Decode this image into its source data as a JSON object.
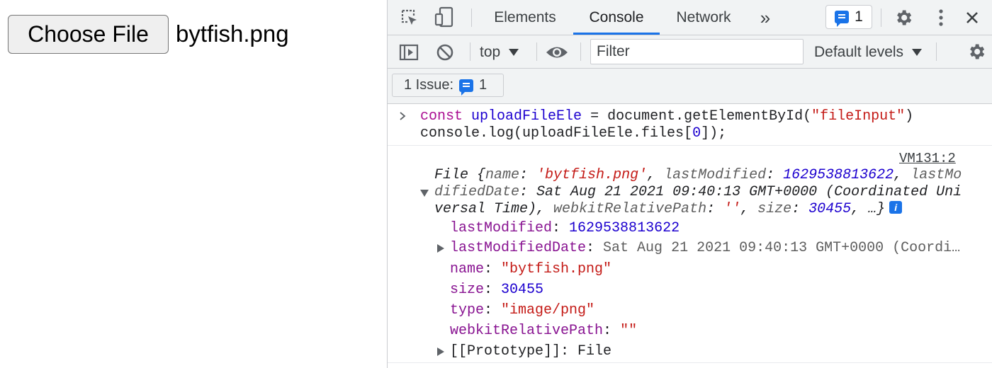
{
  "page": {
    "file_button_label": "Choose File",
    "file_name": "bytfish.png"
  },
  "devtools": {
    "tabs": [
      "Elements",
      "Console",
      "Network"
    ],
    "active_tab": "Console",
    "more_tabs_glyph": "»",
    "message_badge_count": "1",
    "context": "top",
    "filter_placeholder": "Filter",
    "levels_label": "Default levels",
    "issues_label": "1 Issue:",
    "issues_count": "1",
    "accent_color": "#1a73e8",
    "icons": [
      "inspect-element-icon",
      "device-toggle-icon",
      "settings-gear-icon",
      "kebab-menu-icon",
      "close-icon",
      "sidebar-toggle-icon",
      "clear-console-icon",
      "eye-icon",
      "chat-bubble-icon"
    ]
  },
  "console": {
    "input_line1": {
      "kw": "const",
      "var": "uploadFileEle",
      "eq": " = document.getElementById(",
      "str": "\"fileInput\"",
      "close": ")"
    },
    "input_line2": {
      "pre": "console.log(uploadFileEle.files[",
      "idx": "0",
      "post": "]);"
    },
    "source_link": "VM131:2",
    "summary": {
      "l1a": "File {",
      "l1k1": "name",
      "l1c": ": ",
      "l1s": "'bytfish.png'",
      "l1d": ", ",
      "l1k2": "lastModified",
      "l1e": ": ",
      "l1n": "1629538813622",
      "l1f": ", ",
      "l1k3": "lastMo",
      "l2k": "difiedDate",
      "l2v": ": Sat Aug 21 2021 09:40:13 GMT+0000 (Coordinated Uni",
      "l3a": "versal Time), ",
      "l3k1": "webkitRelativePath",
      "l3b": ": ",
      "l3s": "''",
      "l3c": ", ",
      "l3k2": "size",
      "l3d": ": ",
      "l3n": "30455",
      "l3e": ", …}",
      "info_glyph": "i"
    },
    "properties": {
      "lastModified_key": "lastModified",
      "lastModified_val": "1629538813622",
      "lastModifiedDate_key": "lastModifiedDate",
      "lastModifiedDate_val": "Sat Aug 21 2021 09:40:13 GMT+0000 (Coordi…",
      "name_key": "name",
      "name_val": "\"bytfish.png\"",
      "size_key": "size",
      "size_val": "30455",
      "type_key": "type",
      "type_val": "\"image/png\"",
      "webkit_key": "webkitRelativePath",
      "webkit_val": "\"\"",
      "proto_key": "[[Prototype]]",
      "proto_val": "File"
    }
  }
}
